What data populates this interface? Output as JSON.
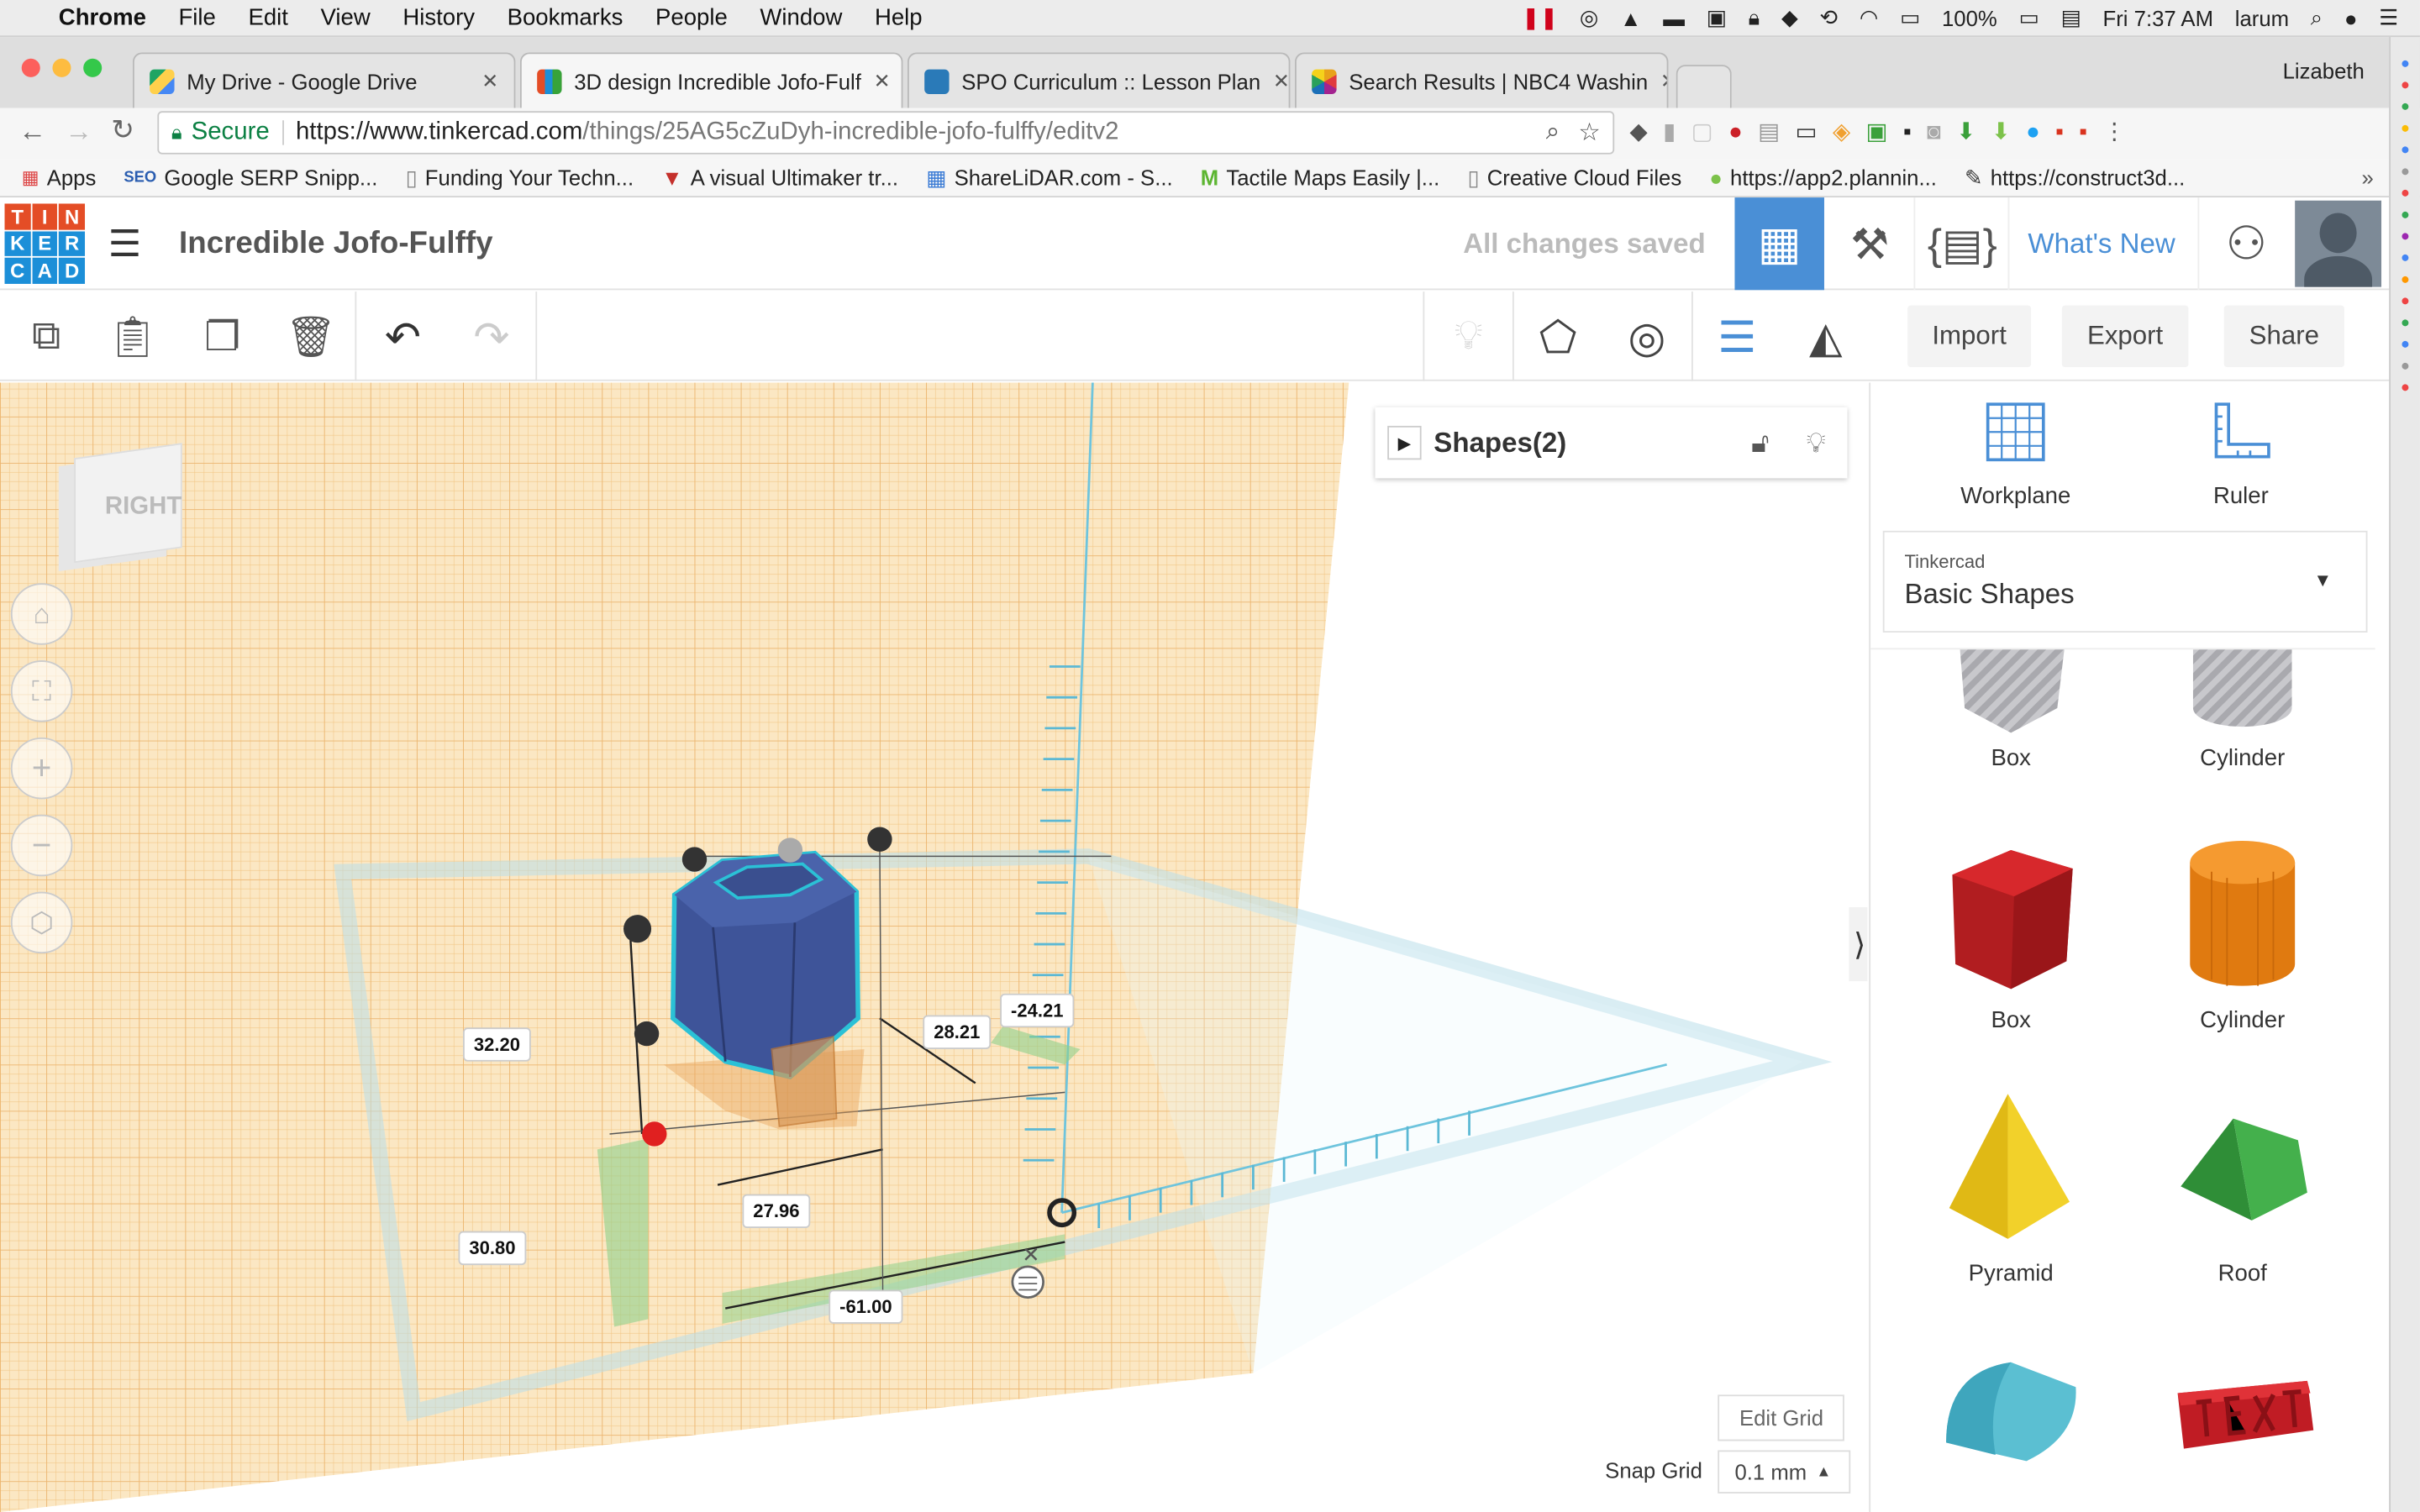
{
  "menubar": {
    "app": "Chrome",
    "items": [
      "File",
      "Edit",
      "View",
      "History",
      "Bookmarks",
      "People",
      "Window",
      "Help"
    ],
    "battery": "100%",
    "clock": "Fri 7:37 AM",
    "user": "larum"
  },
  "tabs": [
    {
      "title": "My Drive - Google Drive",
      "fav": "#1fa463"
    },
    {
      "title": "3D design Incredible Jofo-Fulf",
      "fav": "#e44d26"
    },
    {
      "title": "SPO Curriculum :: Lesson Plan",
      "fav": "#2a7ab8"
    },
    {
      "title": "Search Results | NBC4 Washin",
      "fav": "#e8a21a"
    }
  ],
  "profile": "Lizabeth",
  "address": {
    "secure": "Secure",
    "url_host": "https://www.tinkercad.com",
    "url_path": "/things/25AG5cZuDyh-incredible-jofo-fulffy/editv2"
  },
  "bookmarks": [
    "Apps",
    "Google SERP Snipp...",
    "Funding Your Techn...",
    "A visual Ultimaker tr...",
    "ShareLiDAR.com - S...",
    "Tactile Maps Easily |...",
    "Creative Cloud Files",
    "https://app2.plannin...",
    "https://construct3d..."
  ],
  "tinkercad": {
    "logo": [
      "T",
      "I",
      "N",
      "K",
      "E",
      "R",
      "C",
      "A",
      "D"
    ],
    "title": "Incredible Jofo-Fulffy",
    "status": "All changes saved",
    "whats_new": "What's New",
    "actions": {
      "import": "Import",
      "export": "Export",
      "share": "Share"
    },
    "viewcube": "RIGHT",
    "shapes_panel": {
      "label": "Shapes(2)"
    },
    "dimensions": {
      "d1": "32.20",
      "d2": "28.21",
      "d3": "-24.21",
      "d4": "30.80",
      "d5": "27.96",
      "d6": "-61.00"
    },
    "edit_grid": "Edit Grid",
    "snap_grid_label": "Snap Grid",
    "snap_grid_value": "0.1 mm",
    "panel": {
      "workplane": "Workplane",
      "ruler": "Ruler",
      "library_source": "Tinkercad",
      "library_name": "Basic Shapes",
      "shapes": [
        "Box",
        "Cylinder",
        "Box",
        "Cylinder",
        "Pyramid",
        "Roof"
      ]
    }
  },
  "colors": {
    "accent": "#4a8fd6",
    "grid": "#f5c98a",
    "shape": "#3e5499",
    "selection": "#2bc1d6"
  }
}
